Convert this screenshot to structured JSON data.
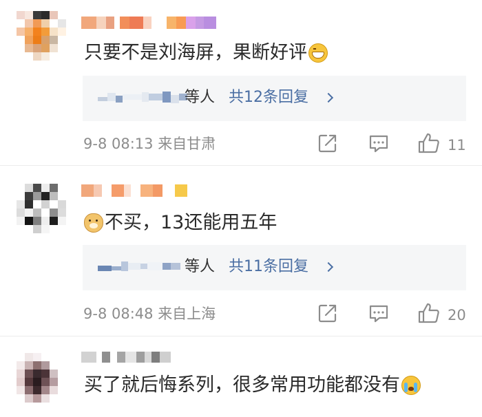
{
  "comments": [
    {
      "text": "只要不是刘海屏，果断好评",
      "emoji": "grin-emoji",
      "reply": {
        "people": "等人",
        "count": "共12条回复"
      },
      "time": "9-8 08:13",
      "location": "来自甘肃",
      "likes": "11"
    },
    {
      "text": "不买，13还能用五年",
      "emoji": "doge-emoji",
      "reply": {
        "people": "等人",
        "count": "共11条回复"
      },
      "time": "9-8 08:48",
      "location": "来自上海",
      "likes": "20"
    },
    {
      "text": "买了就后悔系列，很多常用功能都没有",
      "emoji": "crying-emoji"
    }
  ],
  "icons": {
    "share": "share-icon",
    "comment": "comment-icon",
    "like": "thumbs-up-icon",
    "chevron": "chevron-right-icon"
  },
  "colors": {
    "link": "#4a6ea3",
    "meta": "#8c8c8c",
    "text": "#2a2a2a",
    "reply_bg": "#f5f6f7"
  }
}
